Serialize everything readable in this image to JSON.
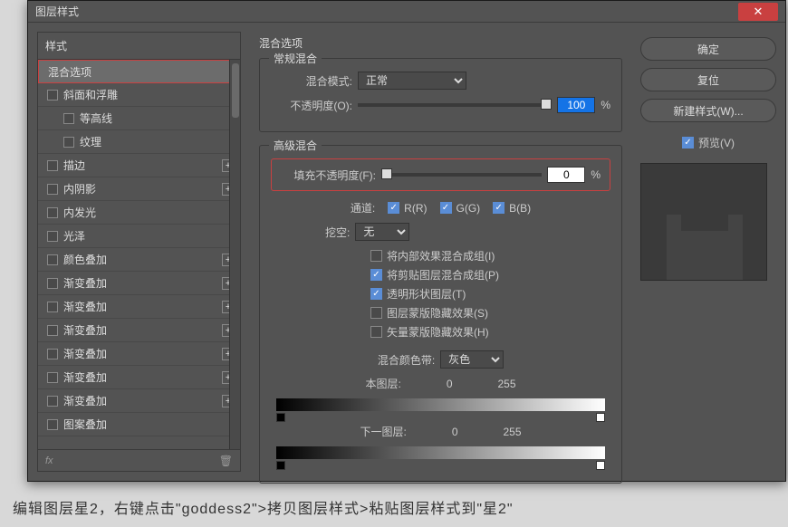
{
  "window": {
    "title": "图层样式"
  },
  "left": {
    "header": "样式",
    "items": [
      {
        "label": "混合选项",
        "checked": false,
        "hasAdd": false,
        "selected": true
      },
      {
        "label": "斜面和浮雕",
        "checked": false,
        "hasAdd": false
      },
      {
        "label": "等高线",
        "checked": false,
        "hasAdd": false,
        "sub": true
      },
      {
        "label": "纹理",
        "checked": false,
        "hasAdd": false,
        "sub": true
      },
      {
        "label": "描边",
        "checked": false,
        "hasAdd": true
      },
      {
        "label": "内阴影",
        "checked": false,
        "hasAdd": true
      },
      {
        "label": "内发光",
        "checked": false,
        "hasAdd": false
      },
      {
        "label": "光泽",
        "checked": false,
        "hasAdd": false
      },
      {
        "label": "颜色叠加",
        "checked": false,
        "hasAdd": true
      },
      {
        "label": "渐变叠加",
        "checked": false,
        "hasAdd": true
      },
      {
        "label": "渐变叠加",
        "checked": false,
        "hasAdd": true
      },
      {
        "label": "渐变叠加",
        "checked": false,
        "hasAdd": true
      },
      {
        "label": "渐变叠加",
        "checked": false,
        "hasAdd": true
      },
      {
        "label": "渐变叠加",
        "checked": false,
        "hasAdd": true
      },
      {
        "label": "渐变叠加",
        "checked": false,
        "hasAdd": true
      },
      {
        "label": "图案叠加",
        "checked": false,
        "hasAdd": false
      }
    ],
    "fxLabel": "fx",
    "trash": "🗑"
  },
  "center": {
    "mainTitle": "混合选项",
    "normal": {
      "title": "常规混合",
      "modeLabel": "混合模式:",
      "modeValue": "正常",
      "opacityLabel": "不透明度(O):",
      "opacityValue": "100",
      "pct": "%"
    },
    "advanced": {
      "title": "高级混合",
      "fillLabel": "填充不透明度(F):",
      "fillValue": "0",
      "pct": "%",
      "channelLabel": "通道:",
      "chR": "R(R)",
      "chG": "G(G)",
      "chB": "B(B)",
      "knockoutLabel": "挖空:",
      "knockoutValue": "无",
      "opts": [
        {
          "label": "将内部效果混合成组(I)",
          "checked": false
        },
        {
          "label": "将剪贴图层混合成组(P)",
          "checked": true
        },
        {
          "label": "透明形状图层(T)",
          "checked": true
        },
        {
          "label": "图层蒙版隐藏效果(S)",
          "checked": false
        },
        {
          "label": "矢量蒙版隐藏效果(H)",
          "checked": false
        }
      ]
    },
    "blendif": {
      "label": "混合颜色带:",
      "value": "灰色",
      "thisLabel": "本图层:",
      "nextLabel": "下一图层:",
      "min": "0",
      "max": "255"
    }
  },
  "right": {
    "ok": "确定",
    "reset": "复位",
    "newStyle": "新建样式(W)...",
    "preview": "预览(V)"
  },
  "caption": "编辑图层星2，右键点击\"goddess2\">拷贝图层样式>粘贴图层样式到\"星2\""
}
